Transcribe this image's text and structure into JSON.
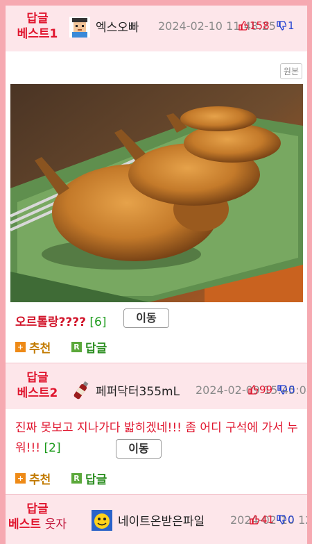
{
  "posts": [
    {
      "best_label_1": "답글",
      "best_label_2": "베스트1",
      "author": "엑스오빠",
      "date": "2024-02-10 11:48:25",
      "up": "158",
      "down": "1",
      "original_label": "원본",
      "title": "오르톨랑????",
      "reply_count": "[6]",
      "move_label": "이동",
      "recommend_label": "추천",
      "reply_label": "답글"
    },
    {
      "best_label_1": "답글",
      "best_label_2": "베스트2",
      "author": "페퍼닥터355mL",
      "date": "2024-02-09 15:45:08",
      "up": "99",
      "down": "0",
      "comment": "진짜 못보고 지나가다 밟히겠네!!! 좀 어디 구석에 가서 누워!!!",
      "reply_count": "[2]",
      "move_label": "이동",
      "recommend_label": "추천",
      "reply_label": "답글"
    },
    {
      "best_label_1": "답글",
      "best_label_2": "베스트",
      "best_suffix": "웃자",
      "author": "네이트온받은파일",
      "date": "2024-02-10 12:...",
      "up": "41",
      "down": "0"
    }
  ],
  "icons": {
    "recommend_badge": "+",
    "reply_badge": "R",
    "thumb_up": "thumbs-up-icon",
    "thumb_down": "thumbs-down-icon"
  },
  "colors": {
    "outer_border": "#f6a9b1",
    "header_bg": "#fde6ea",
    "best_red": "#e0142d",
    "down_blue": "#1e3ed1",
    "count_green": "#1b9a1b"
  }
}
